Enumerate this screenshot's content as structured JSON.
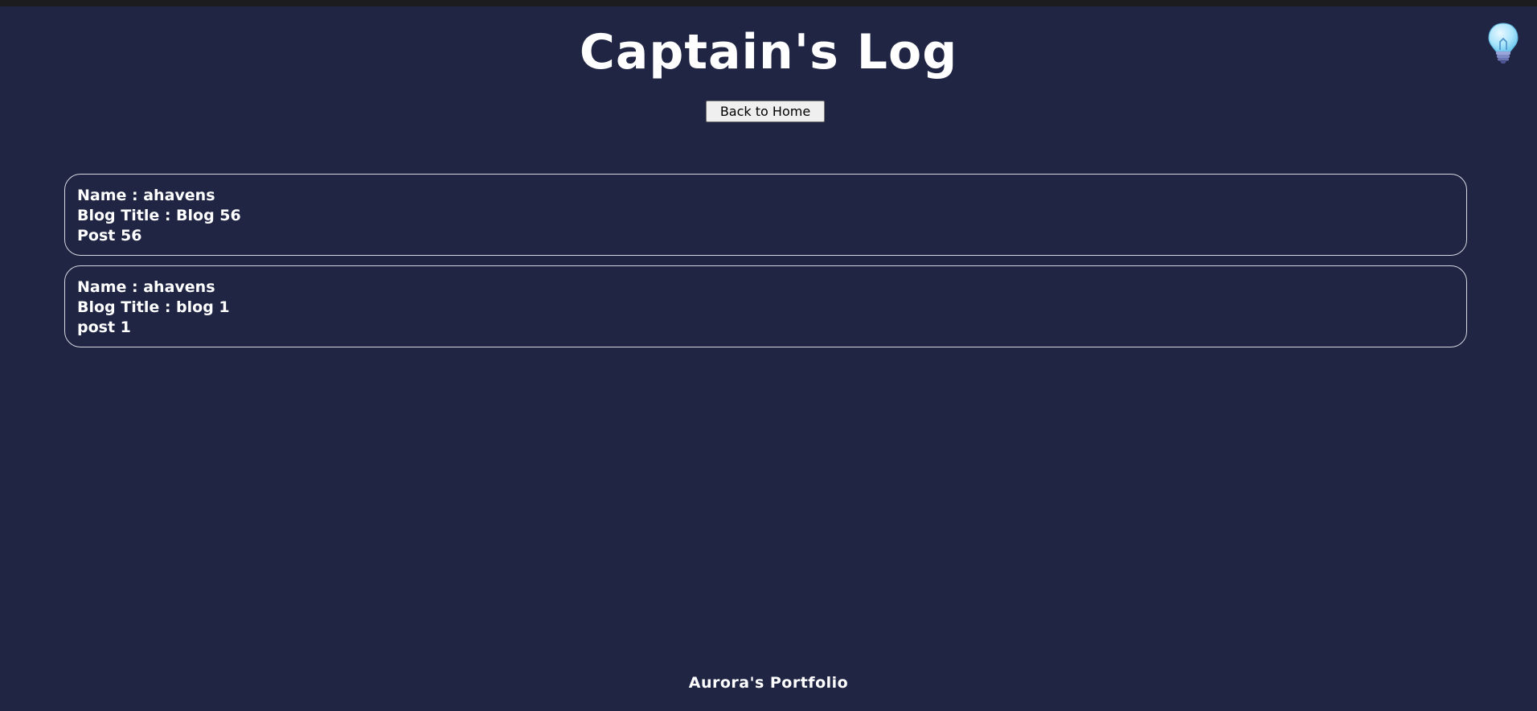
{
  "header": {
    "title": "Captain's Log",
    "theme_toggle_icon": "lightbulb-icon"
  },
  "nav": {
    "back_label": "Back to Home"
  },
  "posts": [
    {
      "name_line": "Name : ahavens",
      "title_line": "Blog Title : Blog 56",
      "body": "Post 56"
    },
    {
      "name_line": "Name : ahavens",
      "title_line": "Blog Title : blog 1",
      "body": "post 1"
    }
  ],
  "footer": {
    "text": "Aurora's Portfolio"
  },
  "colors": {
    "background": "#1f2543",
    "text": "#ffffff",
    "card_border": "#d7d9e2",
    "button_bg": "#efefef"
  }
}
